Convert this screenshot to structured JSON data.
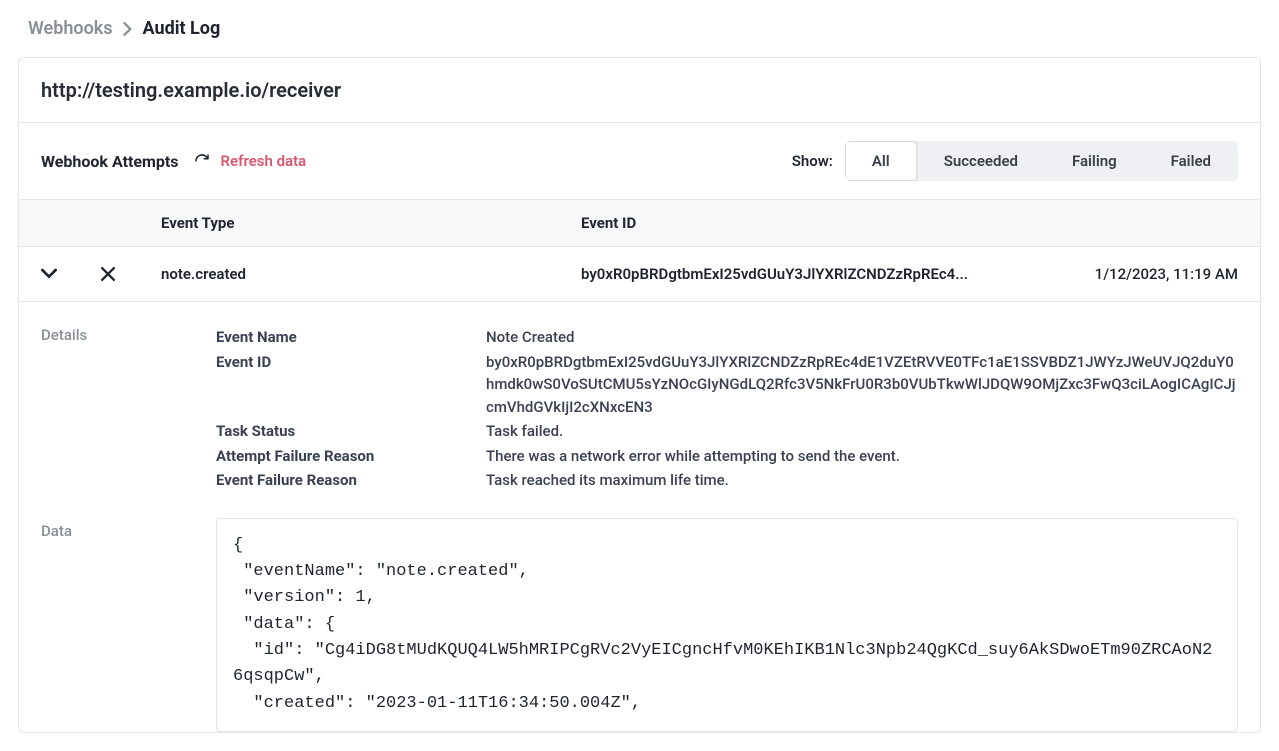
{
  "breadcrumb": {
    "parent": "Webhooks",
    "current": "Audit Log"
  },
  "header": {
    "endpoint": "http://testing.example.io/receiver"
  },
  "toolbar": {
    "section_label": "Webhook Attempts",
    "refresh_label": "Refresh data",
    "show_label": "Show:",
    "filters": {
      "all": "All",
      "succeeded": "Succeeded",
      "failing": "Failing",
      "failed": "Failed"
    },
    "active_filter": "all"
  },
  "table": {
    "headers": {
      "event_type": "Event Type",
      "event_id": "Event ID"
    },
    "rows": [
      {
        "expanded": true,
        "status": "failed",
        "event_type": "note.created",
        "event_id_truncated": "by0xR0pBRDgtbmExI25vdGUuY3JlYXRlZCNDZzRpREc4...",
        "timestamp": "1/12/2023, 11:19 AM"
      }
    ]
  },
  "details": {
    "section_label": "Details",
    "fields": {
      "event_name": {
        "label": "Event Name",
        "value": "Note Created"
      },
      "event_id": {
        "label": "Event ID",
        "value": "by0xR0pBRDgtbmExI25vdGUuY3JlYXRlZCNDZzRpREc4dE1VZEtRVVE0TFc1aE1SSVBDZ1JWYzJWeUVJQ2duY0hmdk0wS0VoSUtCMU5sYzNOcGIyNGdLQ2Rfc3V5NkFrU0R3b0VUbTkwWlJDQW9OMjZxc3FwQ3ciLAogICAgICJjcmVhdGVkIjI2cXNxcEN3"
      },
      "task_status": {
        "label": "Task Status",
        "value": "Task failed."
      },
      "attempt_failure_reason": {
        "label": "Attempt Failure Reason",
        "value": "There was a network error while attempting to send the event."
      },
      "event_failure_reason": {
        "label": "Event Failure Reason",
        "value": "Task reached its maximum life time."
      }
    }
  },
  "data_section": {
    "section_label": "Data",
    "payload": "{\n \"eventName\": \"note.created\",\n \"version\": 1,\n \"data\": {\n  \"id\": \"Cg4iDG8tMUdKQUQ4LW5hMRIPCgRVc2VyEICgncHfvM0KEhIKB1Nlc3Npb24QgKCd_suy6AkSDwoETm90ZRCAoN26qsqpCw\",\n  \"created\": \"2023-01-11T16:34:50.004Z\","
  }
}
